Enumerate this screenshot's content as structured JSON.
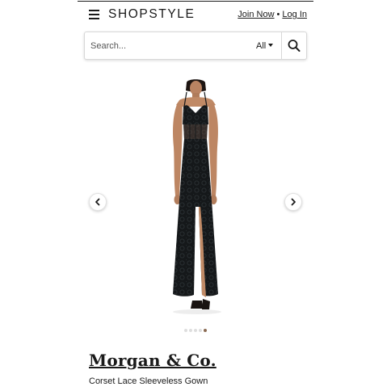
{
  "header": {
    "logo": "SHOPSTYLE",
    "join_label": "Join Now",
    "separator": "•",
    "login_label": "Log In",
    "menu_icon": "hamburger-menu-icon"
  },
  "search": {
    "placeholder": "Search...",
    "scope_label": "All",
    "button_icon": "search-icon"
  },
  "carousel": {
    "total_images": 5,
    "active_index": 4,
    "prev_icon": "chevron-left-icon",
    "next_icon": "chevron-right-icon"
  },
  "product": {
    "brand": "Morgan & Co.",
    "name": "Corset Lace Sleeveless Gown",
    "image": "black-lace-gown-photo"
  },
  "colors": {
    "text": "#1a1a1a",
    "dress": "#15181a",
    "skin": "#c08a66",
    "active_dot": "#8a6a52",
    "inactive_dot": "#dedede"
  }
}
